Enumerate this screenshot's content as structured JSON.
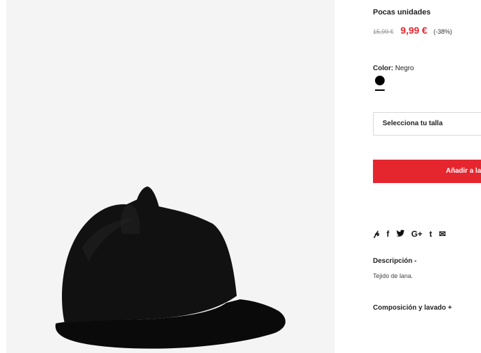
{
  "product": {
    "image_alt": "cat ear felt cap",
    "stock_status": "Pocas unidades",
    "price": {
      "old": "15,99 €",
      "current": "9,99 €",
      "discount": "(-38%)"
    },
    "color": {
      "label": "Color:",
      "value": "Negro",
      "swatch_color": "#000000"
    },
    "size_select": {
      "placeholder": "Selecciona tu talla"
    },
    "add_button": {
      "label": "Añadir a la cesta"
    },
    "share": [
      {
        "icon": "pinterest-icon",
        "glyph": "𝓅"
      },
      {
        "icon": "facebook-icon",
        "glyph": "f"
      },
      {
        "icon": "twitter-icon",
        "glyph": "🐦"
      },
      {
        "icon": "google-plus-icon",
        "glyph": "G+"
      },
      {
        "icon": "tumblr-icon",
        "glyph": "t"
      },
      {
        "icon": "email-icon",
        "glyph": "✉"
      }
    ],
    "description": {
      "title": "Descripción -",
      "text": "Tejido de lana."
    },
    "composition": {
      "title": "Composición y lavado +"
    }
  },
  "colors": {
    "accent": "#e5262f",
    "image_bg": "#f4f4f4"
  }
}
